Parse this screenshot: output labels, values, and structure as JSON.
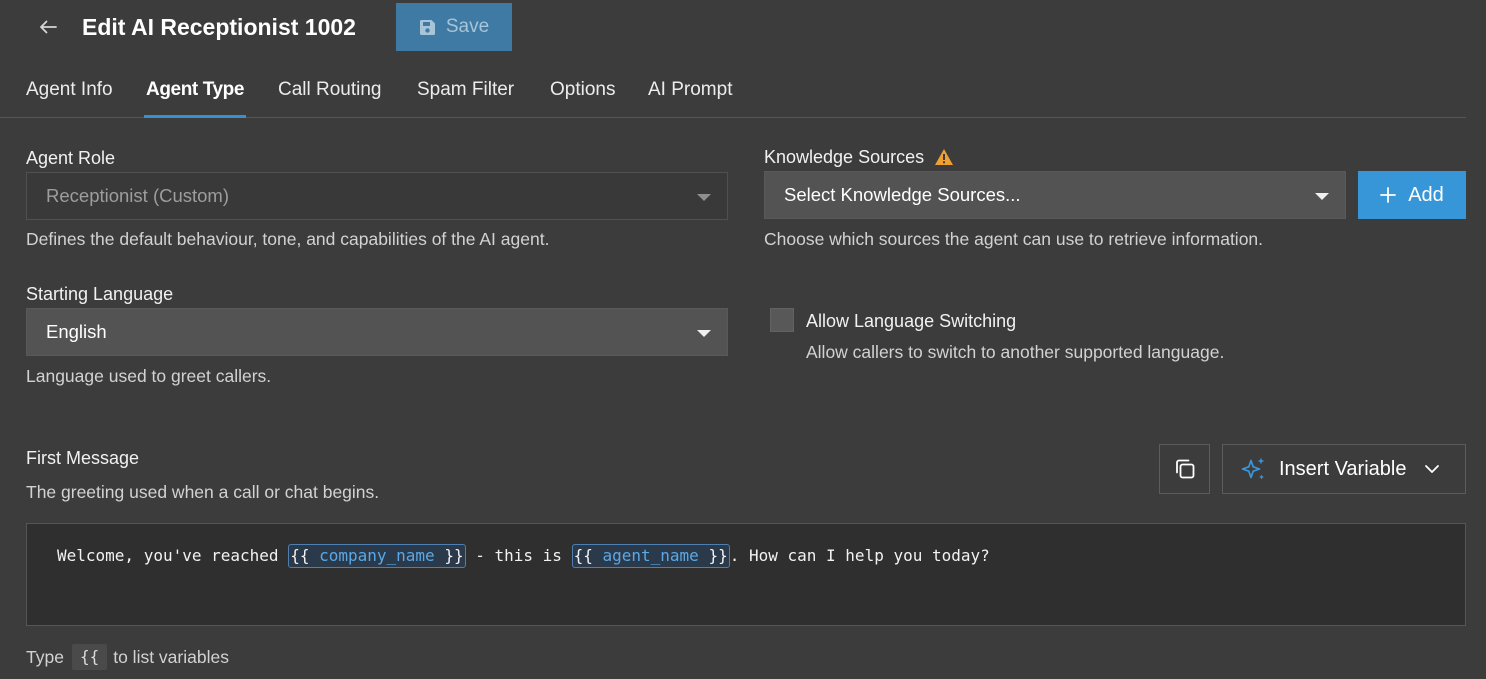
{
  "header": {
    "title": "Edit AI Receptionist 1002",
    "save_label": "Save"
  },
  "tabs": [
    {
      "label": "Agent Info",
      "active": false
    },
    {
      "label": "Agent Type",
      "active": true
    },
    {
      "label": "Call Routing",
      "active": false
    },
    {
      "label": "Spam Filter",
      "active": false
    },
    {
      "label": "Options",
      "active": false
    },
    {
      "label": "AI Prompt",
      "active": false
    }
  ],
  "agent_role": {
    "label": "Agent Role",
    "value": "Receptionist (Custom)",
    "help": "Defines the default behaviour, tone, and capabilities of the AI agent."
  },
  "knowledge_sources": {
    "label": "Knowledge Sources",
    "placeholder": "Select Knowledge Sources...",
    "add_label": "Add",
    "help": "Choose which sources the agent can use to retrieve information."
  },
  "starting_language": {
    "label": "Starting Language",
    "value": "English",
    "help": "Language used to greet callers."
  },
  "language_switching": {
    "label": "Allow Language Switching",
    "help": "Allow callers to switch to another supported language.",
    "checked": false
  },
  "first_message": {
    "label": "First Message",
    "help": "The greeting used when a call or chat begins.",
    "insert_variable_label": "Insert Variable",
    "segment_1": "Welcome, you've reached ",
    "var_open": "{{",
    "var_close": "}}",
    "var_1": "company_name",
    "segment_2": " - this is ",
    "var_2": "agent_name",
    "segment_3": ". How can I help you today?",
    "hint_prefix": "Type",
    "hint_code": "{{",
    "hint_suffix": "to list variables"
  },
  "colors": {
    "background": "#3c3c3c",
    "accent": "#3796d7",
    "save_button": "#3e7aa3",
    "warning": "#f0a030",
    "variable_text": "#5aa8e6"
  },
  "icons": {
    "back": "arrow-left-icon",
    "save": "floppy-disk-icon",
    "warning": "warning-triangle-icon",
    "add": "plus-icon",
    "copy": "copy-icon",
    "sparkle": "sparkle-icon",
    "chevron": "chevron-down-icon"
  }
}
